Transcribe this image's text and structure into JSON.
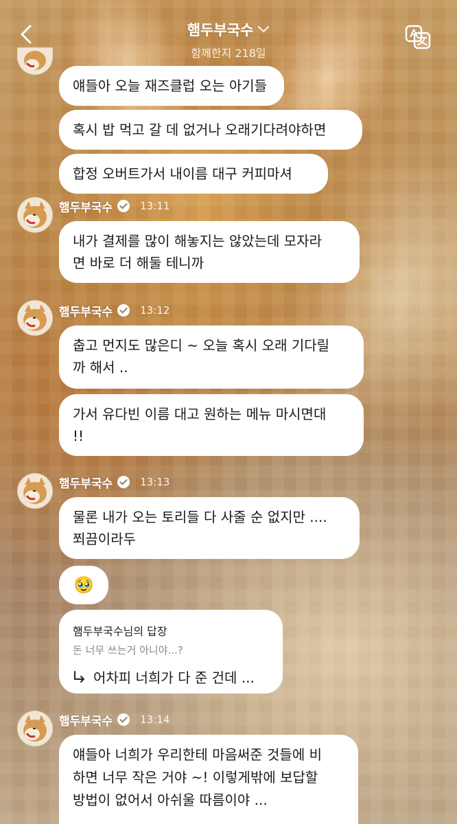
{
  "header": {
    "title": "햄두부국수",
    "subtitle": "함께한지 218일"
  },
  "messages_top": [
    "얘들아 오늘 재즈클럽 오는 아기들",
    "혹시 밥 먹고 갈 데 없거나 오래기다려야하면",
    "합정 오버트가서 내이름 대구 커피마셔"
  ],
  "groups": [
    {
      "sender": "햄두부국수",
      "time": "13:11",
      "bubbles": [
        [
          "내가 결제를 많이 해놓지는 않았는데 모자라",
          "면 바로 더 해둘 테니까"
        ]
      ]
    },
    {
      "sender": "햄두부국수",
      "time": "13:12",
      "bubbles": [
        [
          "춥고 먼지도 많은디 ~ 오늘 혹시 오래 기다릴",
          "까 해서 .."
        ],
        [
          "가서 유다빈 이름 대고 원하는 메뉴 마시면대",
          "!!"
        ]
      ]
    },
    {
      "sender": "햄두부국수",
      "time": "13:13",
      "bubbles": [
        [
          "물론 내가 오는 토리들 다 사줄 순 없지만 ....",
          "쬐끔이라두"
        ],
        [
          "🥹"
        ]
      ],
      "reply": {
        "title": "햄두부국수님의 답장",
        "quote": "돈 너무 쓰는거 아니야...?",
        "text": "어차피 너희가 다 준 건데 ..."
      }
    },
    {
      "sender": "햄두부국수",
      "time": "13:14",
      "bubbles": [
        [
          "얘들아 너희가 우리한테 마음써준 것들에 비",
          "하면 너무 작은 거야 ~! 이렇게밖에 보답할",
          "방법이 없어서 아쉬울 따름이야 ..."
        ]
      ]
    }
  ],
  "icons": {
    "back": "chevron-left-icon",
    "title_chevron": "chevron-down-icon",
    "translate": "translate-icon",
    "verified": "verified-badge-icon",
    "reply_arrow": "reply-arrow-icon"
  },
  "colors": {
    "bubble": "#ffffff",
    "header_text": "#ffffff"
  }
}
